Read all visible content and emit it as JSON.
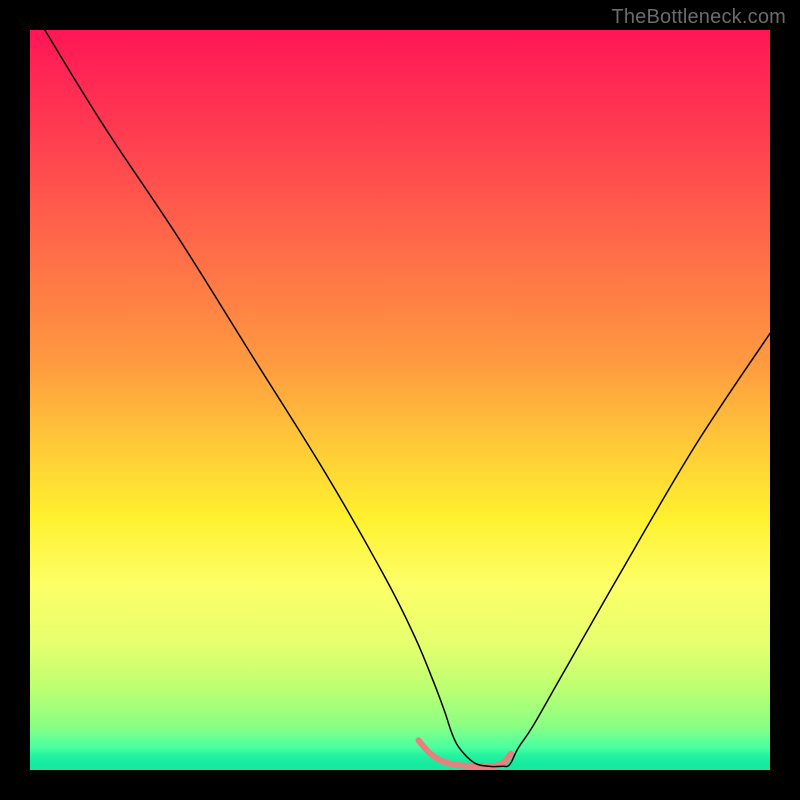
{
  "watermark": "TheBottleneck.com",
  "chart_data": {
    "type": "line",
    "title": "",
    "xlabel": "",
    "ylabel": "",
    "xlim": [
      0,
      100
    ],
    "ylim": [
      0,
      100
    ],
    "background_gradient_stops": [
      {
        "pct": 0,
        "color": "#ff1656"
      },
      {
        "pct": 15,
        "color": "#ff3f50"
      },
      {
        "pct": 30,
        "color": "#ff6d48"
      },
      {
        "pct": 45,
        "color": "#ff9a40"
      },
      {
        "pct": 56,
        "color": "#ffc938"
      },
      {
        "pct": 66,
        "color": "#fff12f"
      },
      {
        "pct": 75,
        "color": "#fdff68"
      },
      {
        "pct": 83,
        "color": "#e6ff6e"
      },
      {
        "pct": 89,
        "color": "#bcff71"
      },
      {
        "pct": 94,
        "color": "#8bff83"
      },
      {
        "pct": 97,
        "color": "#49ffa1"
      },
      {
        "pct": 98,
        "color": "#24f49f"
      },
      {
        "pct": 99,
        "color": "#16eb9f"
      },
      {
        "pct": 100,
        "color": "#15ea9f"
      }
    ],
    "series": [
      {
        "name": "black-curve",
        "color": "#000000",
        "width": 1.5,
        "x": [
          2,
          10,
          20,
          30,
          40,
          48,
          52,
          54.5,
          56,
          57,
          58,
          60,
          62,
          64,
          64.5,
          65,
          66,
          68,
          72,
          80,
          90,
          100
        ],
        "y": [
          100,
          87,
          72,
          56,
          40,
          26,
          18,
          12,
          8,
          5,
          3,
          1,
          0.5,
          0.5,
          0.5,
          1,
          3,
          6,
          13,
          27,
          44,
          59
        ]
      },
      {
        "name": "pink-floor-band",
        "color": "#e98080",
        "width": 6,
        "x": [
          52.5,
          54,
          55.5,
          57,
          58.5,
          60,
          61,
          62,
          63,
          64,
          65
        ],
        "y": [
          4,
          2.3,
          1.3,
          0.8,
          0.6,
          0.5,
          0.5,
          0.5,
          0.6,
          1.0,
          2.2
        ]
      }
    ]
  }
}
